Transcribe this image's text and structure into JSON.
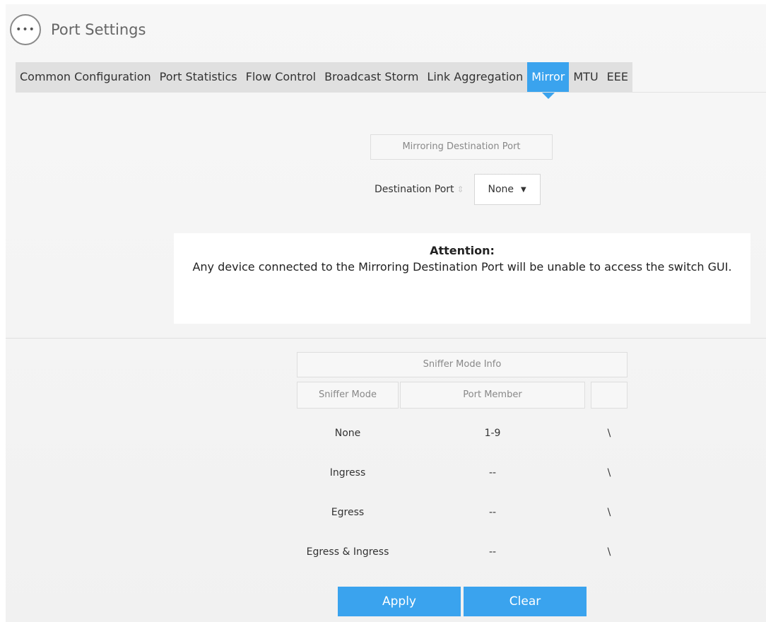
{
  "header": {
    "menu_icon": "•••",
    "title": "Port Settings"
  },
  "tabs": [
    {
      "label": "Common Configuration",
      "active": false
    },
    {
      "label": "Port Statistics",
      "active": false
    },
    {
      "label": "Flow Control",
      "active": false
    },
    {
      "label": "Broadcast Storm",
      "active": false
    },
    {
      "label": "Link Aggregation",
      "active": false
    },
    {
      "label": "Mirror",
      "active": true
    },
    {
      "label": "MTU",
      "active": false
    },
    {
      "label": "EEE",
      "active": false
    }
  ],
  "mirror": {
    "section_title": "Mirroring Destination Port",
    "destination_label": "Destination Port",
    "destination_value": "None",
    "caret": "▼"
  },
  "attention": {
    "title": "Attention:",
    "body": "Any device connected to the Mirroring Destination Port will be unable to access the switch GUI."
  },
  "sniffer": {
    "title": "Sniffer Mode Info",
    "col_mode": "Sniffer Mode",
    "col_member": "Port Member",
    "rows": [
      {
        "mode": "None",
        "member": "1-9",
        "action": "\\"
      },
      {
        "mode": "Ingress",
        "member": "--",
        "action": "\\"
      },
      {
        "mode": "Egress",
        "member": "--",
        "action": "\\"
      },
      {
        "mode": "Egress & Ingress",
        "member": "--",
        "action": "\\"
      }
    ]
  },
  "buttons": {
    "apply": "Apply",
    "clear": "Clear"
  },
  "colors": {
    "accent": "#3aa3ee",
    "panel": "#f4f4f4",
    "tab_bar": "#e0e0e0"
  }
}
